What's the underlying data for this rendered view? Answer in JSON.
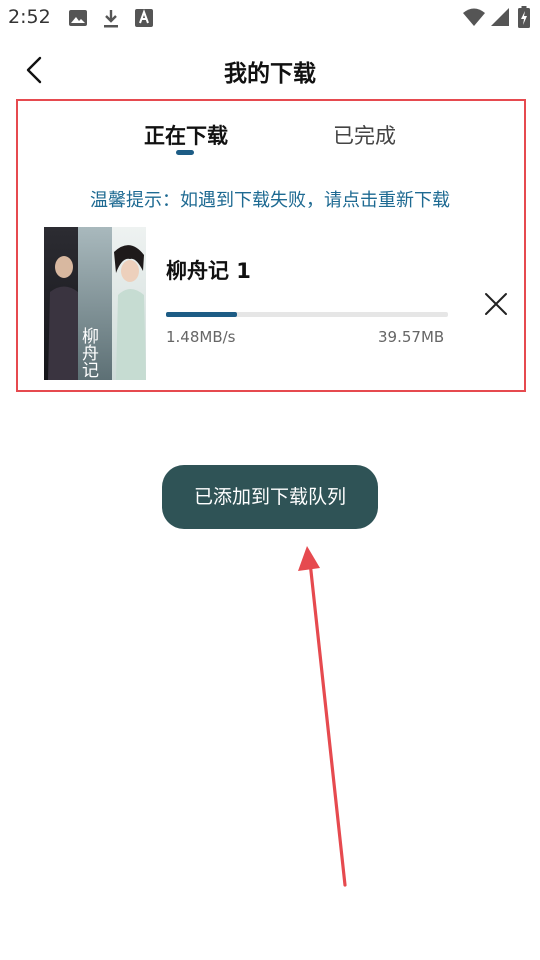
{
  "status_bar": {
    "time": "2:52",
    "left_icons": [
      "image-icon",
      "download-icon",
      "font-a-icon"
    ],
    "right_icons": [
      "wifi-icon",
      "signal-icon",
      "battery-charging-icon"
    ]
  },
  "header": {
    "back_icon": "chevron-left-icon",
    "title": "我的下载"
  },
  "tabs": [
    {
      "label": "正在下载",
      "active": true
    },
    {
      "label": "已完成",
      "active": false
    }
  ],
  "tip": "温馨提示：如遇到下载失败，请点击重新下载",
  "download_item": {
    "title": "柳舟记 1",
    "poster_text": "柳舟记",
    "progress": 0.25,
    "speed": "1.48MB/s",
    "size": "39.57MB",
    "close_icon": "close-icon"
  },
  "toast": "已添加到下载队列",
  "colors": {
    "accent": "#1d5c85",
    "tip": "#1e6a92",
    "toast_bg": "#2f5356",
    "highlight": "#e64a4f"
  }
}
